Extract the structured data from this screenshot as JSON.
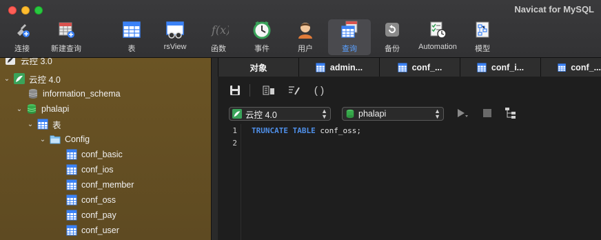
{
  "window": {
    "title": "Navicat for MySQL"
  },
  "toolbar": {
    "items": [
      {
        "label": "连接",
        "icon": "connection-plug-icon"
      },
      {
        "label": "新建查询",
        "icon": "new-query-icon"
      },
      {
        "label": "表",
        "icon": "table-icon"
      },
      {
        "label": "rsView",
        "icon": "view-glasses-icon"
      },
      {
        "label": "函数",
        "icon": "function-fx-icon"
      },
      {
        "label": "事件",
        "icon": "event-clock-icon"
      },
      {
        "label": "用户",
        "icon": "user-icon"
      },
      {
        "label": "查询",
        "icon": "query-icon",
        "active": true
      },
      {
        "label": "备份",
        "icon": "backup-icon"
      },
      {
        "label": "Automation",
        "icon": "automation-checklist-icon"
      },
      {
        "label": "模型",
        "icon": "model-icon"
      }
    ]
  },
  "sidebar": {
    "top_cut_label": "云控 3.0",
    "connection": "云控 4.0",
    "databases": [
      "information_schema",
      "phalapi"
    ],
    "tables_label": "表",
    "group": "Config",
    "tables": [
      "conf_basic",
      "conf_ios",
      "conf_member",
      "conf_oss",
      "conf_pay",
      "conf_user"
    ]
  },
  "tabs": [
    {
      "label": "对象"
    },
    {
      "label": "admin..."
    },
    {
      "label": "conf_..."
    },
    {
      "label": "conf_i..."
    },
    {
      "label": "conf_..."
    }
  ],
  "query": {
    "connection_select": "云控 4.0",
    "database_select": "phalapi",
    "lines": [
      {
        "num": "1",
        "kw1": "TRUNCATE",
        "kw2": "TABLE",
        "rest": " conf_oss;"
      },
      {
        "num": "2"
      }
    ]
  },
  "colors": {
    "accent": "#5aa0ff",
    "keyword": "#4f8fe8",
    "sidebar_bg": "#6b5424"
  }
}
